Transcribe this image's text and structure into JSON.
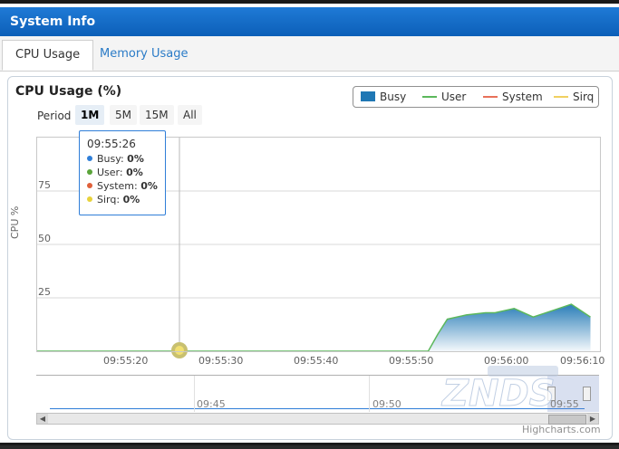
{
  "window": {
    "title": "System Info"
  },
  "tabs": [
    {
      "label": "CPU Usage",
      "active": true
    },
    {
      "label": "Memory Usage",
      "active": false
    }
  ],
  "chart_header": {
    "title": "CPU Usage (%)"
  },
  "period": {
    "label": "Period",
    "options": [
      "1M",
      "5M",
      "15M",
      "All"
    ],
    "selected": "1M"
  },
  "tooltip": {
    "time": "09:55:26",
    "rows": [
      {
        "name": "Busy:",
        "value": "0%",
        "color": "#2f7ed8"
      },
      {
        "name": "User:",
        "value": "0%",
        "color": "#5aa43a"
      },
      {
        "name": "System:",
        "value": "0%",
        "color": "#e0603a"
      },
      {
        "name": "Sirq:",
        "value": "0%",
        "color": "#e8d23a"
      }
    ]
  },
  "navigator": {
    "ticks": [
      "09:45",
      "09:50",
      "09:55"
    ]
  },
  "credits": "Highcharts.com",
  "watermark": "ZNDS",
  "chart_data": {
    "type": "area",
    "title": "CPU Usage (%)",
    "ylabel": "CPU %",
    "ylim": [
      0,
      100
    ],
    "yticks": [
      "25",
      "50",
      "75"
    ],
    "xticks": [
      "09:55:20",
      "09:55:30",
      "09:55:40",
      "09:55:50",
      "09:56:00",
      "09:56:10"
    ],
    "legend_position": "top-right",
    "series": [
      {
        "name": "Busy",
        "color": "#1f77b4",
        "kind": "area",
        "x": [
          "09:55:12",
          "09:55:26",
          "09:55:53",
          "09:55:54",
          "09:55:55",
          "09:55:57",
          "09:55:59",
          "09:56:00",
          "09:56:02",
          "09:56:04",
          "09:56:06",
          "09:56:08",
          "09:56:10"
        ],
        "values": [
          0,
          0,
          0,
          8,
          15,
          17,
          18,
          18,
          20,
          16,
          19,
          22,
          16
        ]
      },
      {
        "name": "User",
        "color": "#5cb85c",
        "kind": "line",
        "x": [
          "09:55:12",
          "09:55:26",
          "09:55:53",
          "09:55:54",
          "09:55:55",
          "09:55:57",
          "09:55:59",
          "09:56:00",
          "09:56:02",
          "09:56:04",
          "09:56:06",
          "09:56:08",
          "09:56:10"
        ],
        "values": [
          0,
          0,
          0,
          8,
          15,
          17,
          18,
          18,
          20,
          16,
          19,
          22,
          16
        ]
      },
      {
        "name": "System",
        "color": "#e8715a",
        "kind": "line",
        "values": [
          0
        ]
      },
      {
        "name": "Sirq",
        "color": "#f0d060",
        "kind": "line",
        "values": [
          0
        ]
      }
    ]
  }
}
